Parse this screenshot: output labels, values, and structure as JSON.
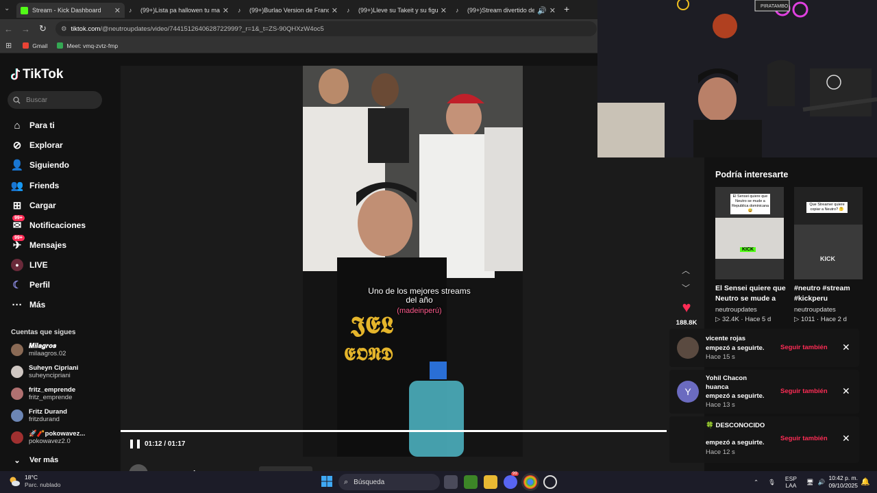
{
  "browser": {
    "tabs": [
      {
        "label": "Stream - Kick Dashboard",
        "icon": "kick-icon",
        "active": true
      },
      {
        "label": "(99+)Lista pa hallowen tu mama",
        "icon": "tiktok-icon",
        "active": false
      },
      {
        "label": "(99+)Burlao Version de Franco",
        "icon": "tiktok-icon",
        "active": false
      },
      {
        "label": "(99+)Lleve su Takeit y su figura",
        "icon": "tiktok-icon",
        "active": false
      },
      {
        "label": "(99+)Stream divertido de N",
        "icon": "tiktok-icon",
        "active": false
      }
    ],
    "url_domain": "tiktok.com",
    "url_path": "/@neutroupdates/video/7441512640628722999?_r=1&_t=ZS-90QHXzW4oc5",
    "bookmarks": [
      {
        "label": "Gmail",
        "icon": "gmail-icon"
      },
      {
        "label": "Meet: vmq-zvtz-fmp",
        "icon": "meet-icon"
      }
    ]
  },
  "tiktok": {
    "logo_text": "TikTok",
    "search_placeholder": "Buscar",
    "nav": [
      {
        "label": "Para ti",
        "icon": "home-icon"
      },
      {
        "label": "Explorar",
        "icon": "compass-icon"
      },
      {
        "label": "Siguiendo",
        "icon": "following-icon"
      },
      {
        "label": "Friends",
        "icon": "friends-icon"
      },
      {
        "label": "Cargar",
        "icon": "upload-icon"
      },
      {
        "label": "Notificaciones",
        "icon": "inbox-icon",
        "badge": "99+"
      },
      {
        "label": "Mensajes",
        "icon": "messages-icon",
        "badge": "99+"
      },
      {
        "label": "LIVE",
        "icon": "live-icon"
      },
      {
        "label": "Perfil",
        "icon": "profile-icon"
      },
      {
        "label": "Más",
        "icon": "more-icon"
      }
    ],
    "following_title": "Cuentas que sigues",
    "following": [
      {
        "name": "𝑴𝒊𝒍𝒂𝒈𝒓𝒐𝒔",
        "handle": "milaagros.02",
        "color": "#8a6a55"
      },
      {
        "name": "Suheyn Cipriani",
        "handle": "suheyncipriani",
        "color": "#cfc7c2"
      },
      {
        "name": "fritz_emprende",
        "handle": "fritz_emprende",
        "color": "#b07070"
      },
      {
        "name": "Fritz Durand",
        "handle": "fritzdurand",
        "color": "#6c86b5"
      },
      {
        "name": "🚀🧨pokowavez...",
        "handle": "pokowavez2.0",
        "color": "#a03030"
      }
    ],
    "see_more": "Ver más",
    "player": {
      "caption_line": "Uno de los mejores streams del año",
      "caption_tag": "(madeinperú)",
      "time": "01:12 / 01:17",
      "progress": 1.0,
      "author": "neutroupdates"
    },
    "likes": "188.8K",
    "recommendations_title": "Podría interesarte",
    "recommendations": [
      {
        "title": "El Sensei quiere que Neutro se mude a R...",
        "user": "neutroupdates",
        "views": "32.4K",
        "age": "Hace 5 d",
        "thumb_text": "El Sensei quiere que Neutro se mude a Republica dominicana 😅",
        "badge": "KICK"
      },
      {
        "title": "#neutro #stream #kickperu",
        "user": "neutroupdates",
        "views": "1011",
        "age": "Hace 2 d",
        "thumb_text": "Que Streamer quiere copiar a Neutro? 🤔",
        "badge": "KICK"
      }
    ]
  },
  "notifications": [
    {
      "name": "vicente rojas",
      "message": "empezó a seguirte.",
      "time": "Hace 15 s",
      "action": "Seguir también",
      "avatar_color": "#5a4a40"
    },
    {
      "name": "Yohil Chacon huanca",
      "message": "empezó a seguirte.",
      "time": "Hace 13 s",
      "action": "Seguir también",
      "avatar_letter": "Y",
      "avatar_color": "#6b6bc0"
    },
    {
      "name": "🍀 DESCONOCIDO",
      "message": "empezó a seguirte.",
      "time": "Hace 12 s",
      "action": "Seguir también",
      "avatar_color": "#2e5a3a"
    }
  ],
  "taskbar": {
    "weather_temp": "18°C",
    "weather_desc": "Parc. nublado",
    "search_label": "Búsqueda",
    "lang_top": "ESP",
    "lang_bottom": "LAA",
    "time": "10:42 p. m.",
    "date": "09/10/2025",
    "discord_badge": "99"
  }
}
